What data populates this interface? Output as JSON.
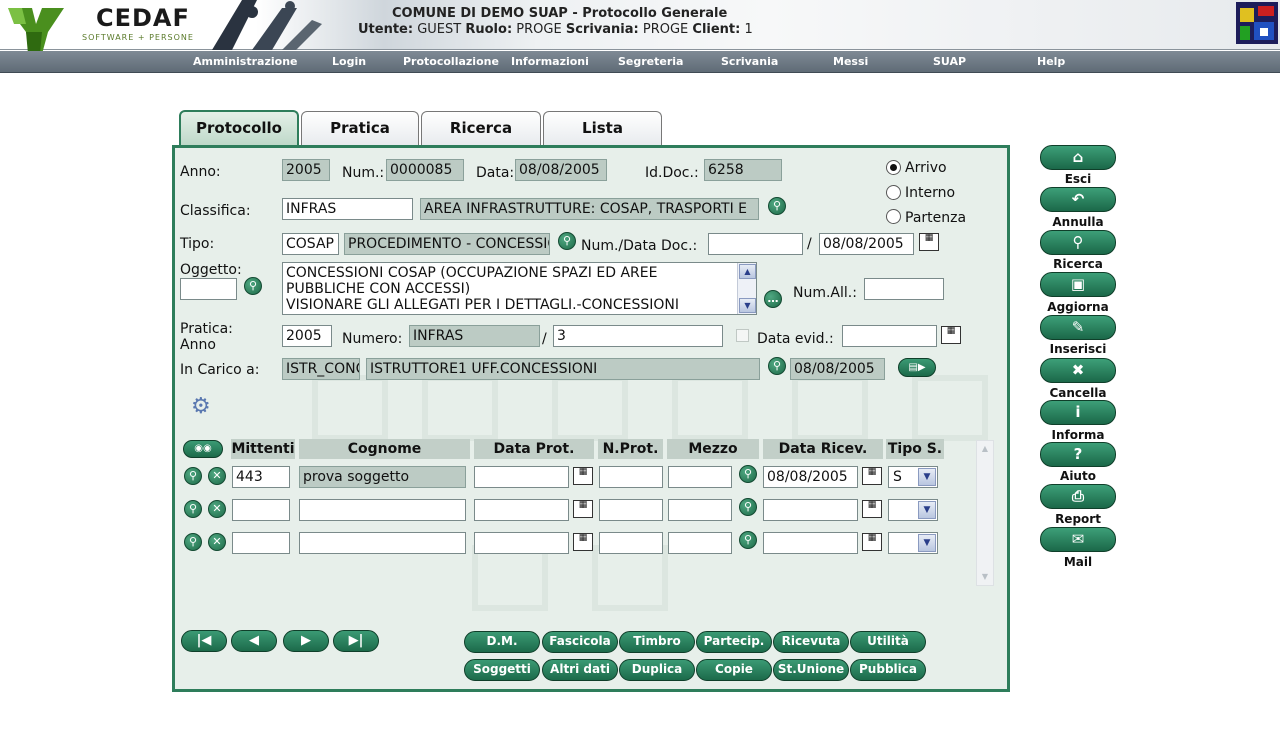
{
  "header": {
    "logo_name": "CEDAF",
    "logo_tagline": "SOFTWARE + PERSONE",
    "title": "COMUNE DI DEMO SUAP - Protocollo Generale",
    "utente_label": "Utente:",
    "utente_value": "GUEST",
    "ruolo_label": "Ruolo:",
    "ruolo_value": "PROGE",
    "scrivania_label": "Scrivania:",
    "scrivania_value": "PROGE",
    "client_label": "Client:",
    "client_value": "1"
  },
  "menu": [
    "Amministrazione",
    "Login",
    "Protocollazione",
    "Informazioni",
    "Segreteria",
    "Scrivania",
    "Messi",
    "SUAP",
    "Help"
  ],
  "tabs": [
    "Protocollo",
    "Pratica",
    "Ricerca",
    "Lista"
  ],
  "form": {
    "anno_label": "Anno:",
    "anno": "2005",
    "num_label": "Num.:",
    "num": "0000085",
    "data_label": "Data:",
    "data": "08/08/2005",
    "iddoc_label": "Id.Doc.:",
    "iddoc": "6258",
    "radio": [
      "Arrivo",
      "Interno",
      "Partenza"
    ],
    "radio_selected": "Arrivo",
    "classifica_label": "Classifica:",
    "classifica_code": "INFRAS",
    "classifica_desc": "AREA INFRASTRUTTURE: COSAP, TRASPORTI E",
    "tipo_label": "Tipo:",
    "tipo_code": "COSAP",
    "tipo_desc": "PROCEDIMENTO - CONCESSIONI",
    "numdatadoc_label": "Num./Data Doc.:",
    "numdoc": "",
    "datadoc": "08/08/2005",
    "oggetto_label": "Oggetto:",
    "oggetto_code": "",
    "oggetto_text": "CONCESSIONI COSAP (OCCUPAZIONE SPAZI ED AREE PUBBLICHE CON ACCESSI)\nVISIONARE GLI ALLEGATI PER I DETTAGLI.-CONCESSIONI",
    "numall_label": "Num.All.:",
    "numall": "",
    "pratica_label": "Pratica:",
    "pratica_anno_label": "Anno",
    "pratica_anno": "2005",
    "numero_label": "Numero:",
    "numero_code": "INFRAS",
    "numero_num": "3",
    "dataevid_label": "Data evid.:",
    "dataevid": "",
    "incarico_label": "In Carico a:",
    "incarico_code": "ISTR_CONC",
    "incarico_desc": "ISTRUTTORE1 UFF.CONCESSIONI",
    "incarico_data": "08/08/2005"
  },
  "grid": {
    "headers": [
      "Mittenti",
      "Cognome",
      "Data Prot.",
      "N.Prot.",
      "Mezzo",
      "Data Ricev.",
      "Tipo S."
    ],
    "rows": [
      {
        "mittente": "443",
        "cognome": "prova soggetto",
        "data_prot": "",
        "nprot": "",
        "mezzo": "",
        "data_ricev": "08/08/2005",
        "tipo": "S"
      },
      {
        "mittente": "",
        "cognome": "",
        "data_prot": "",
        "nprot": "",
        "mezzo": "",
        "data_ricev": "",
        "tipo": ""
      },
      {
        "mittente": "",
        "cognome": "",
        "data_prot": "",
        "nprot": "",
        "mezzo": "",
        "data_ricev": "",
        "tipo": ""
      }
    ]
  },
  "actions_row1": [
    "D.M.",
    "Fascicola",
    "Timbro",
    "Partecip.",
    "Ricevuta",
    "Utilità"
  ],
  "actions_row2": [
    "Soggetti",
    "Altri dati",
    "Duplica",
    "Copie",
    "St.Unione",
    "Pubblica"
  ],
  "side": [
    "Esci",
    "Annulla",
    "Ricerca",
    "Aggiorna",
    "Inserisci",
    "Cancella",
    "Informa",
    "Aiuto",
    "Report",
    "Mail"
  ],
  "colors": {
    "accent": "#2e7d5b",
    "panel": "#e7efea",
    "readonly": "#bccbc4",
    "menubar": "#6b7682"
  }
}
